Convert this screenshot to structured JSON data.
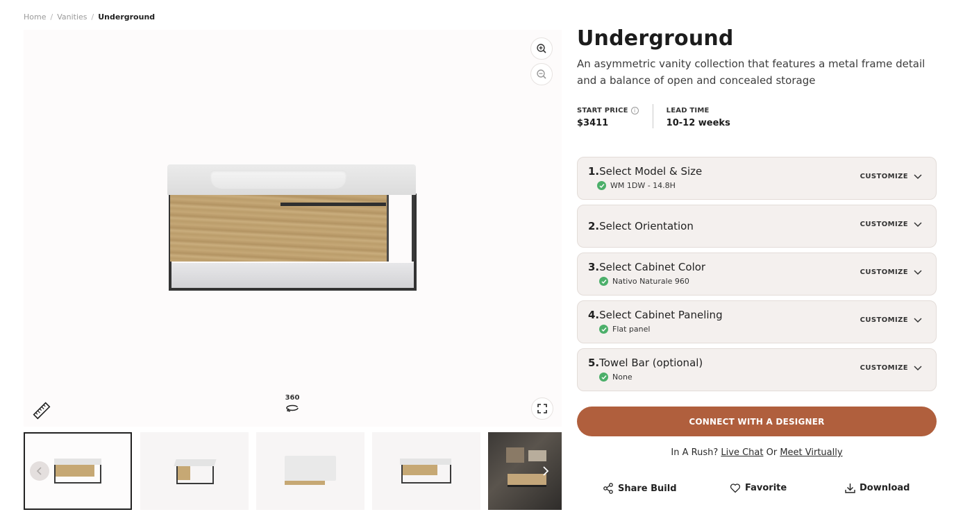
{
  "breadcrumb": {
    "home": "Home",
    "vanities": "Vanities",
    "current": "Underground",
    "separator": "/"
  },
  "viewer": {
    "rotate_label": "360",
    "icons": [
      "zoom-in-icon",
      "zoom-out-icon",
      "ruler-icon",
      "rotate-icon",
      "fullscreen-icon"
    ]
  },
  "thumbnails": {
    "count": 5,
    "active_index": 0,
    "prev_icon": "chevron-left-icon",
    "next_icon": "chevron-right-icon"
  },
  "product": {
    "title": "Underground",
    "description": "An asymmetric vanity collection that features a metal frame detail and a balance of open and concealed storage",
    "start_price_label": "START PRICE",
    "start_price": "$3411",
    "lead_time_label": "LEAD TIME",
    "lead_time": "10-12 weeks"
  },
  "steps": [
    {
      "number": "1.",
      "title": "Select Model & Size",
      "selection": "WM 1DW - 14.8H",
      "action": "CUSTOMIZE"
    },
    {
      "number": "2.",
      "title": "Select Orientation",
      "selection": "",
      "action": "CUSTOMIZE"
    },
    {
      "number": "3.",
      "title": "Select Cabinet Color",
      "selection": "Nativo Naturale 960",
      "action": "CUSTOMIZE"
    },
    {
      "number": "4.",
      "title": "Select Cabinet Paneling",
      "selection": "Flat panel",
      "action": "CUSTOMIZE"
    },
    {
      "number": "5.",
      "title": "Towel Bar (optional)",
      "selection": "None",
      "action": "CUSTOMIZE"
    }
  ],
  "cta": {
    "label": "CONNECT WITH A DESIGNER",
    "color": "#b05f3d"
  },
  "rush": {
    "prefix": "In A Rush?",
    "live_chat": "Live Chat",
    "or": "Or",
    "meet": "Meet Virtually"
  },
  "actions": {
    "share": "Share Build",
    "favorite": "Favorite",
    "download": "Download"
  },
  "colors": {
    "accent": "#b05f3d",
    "step_bg": "#f4f0ee",
    "check": "#4caf6a"
  }
}
